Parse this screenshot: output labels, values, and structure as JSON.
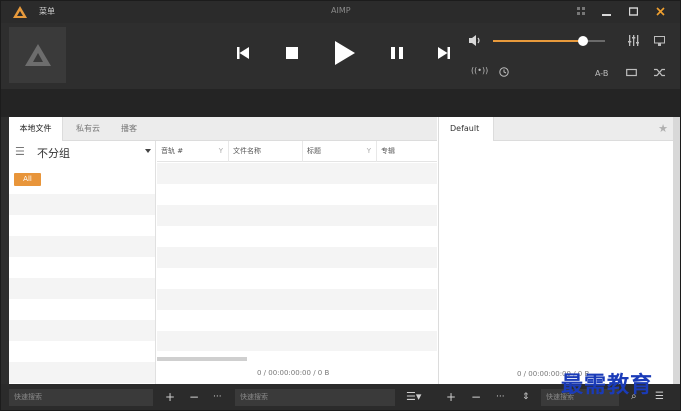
{
  "titlebar": {
    "menu_label": "菜单",
    "app_title": "AIMP",
    "buttons": [
      "grid-icon",
      "minimize-icon",
      "maximize-icon",
      "close-icon"
    ]
  },
  "player": {
    "controls": [
      "previous-icon",
      "stop-icon",
      "play-icon",
      "pause-icon",
      "next-icon"
    ],
    "volume_fraction": 0.8,
    "ab_label": "A-B",
    "accent": "#e89a3c"
  },
  "left_tabs": [
    {
      "label": "本地文件",
      "active": true
    },
    {
      "label": "私有云",
      "active": false
    },
    {
      "label": "播客",
      "active": false
    }
  ],
  "group": {
    "label": "不分组",
    "all_badge": "All"
  },
  "columns": [
    {
      "label": "音轨 #",
      "filter": ""
    },
    {
      "label": "",
      "filter": "Y"
    },
    {
      "label": "文件名称",
      "filter": ""
    },
    {
      "label": "标题",
      "filter": "Y"
    },
    {
      "label": "专辑",
      "filter": ""
    }
  ],
  "status_left": "0 / 00:00:00:00 / 0 B",
  "playlist": {
    "tab_label": "Default",
    "status": "0 / 00:00:00:00 / 0 B"
  },
  "bottom": {
    "search_placeholder_1": "快速搜索",
    "search_placeholder_2": "快速搜索",
    "search_placeholder_3": "快速搜索"
  },
  "watermark": "最需教育"
}
